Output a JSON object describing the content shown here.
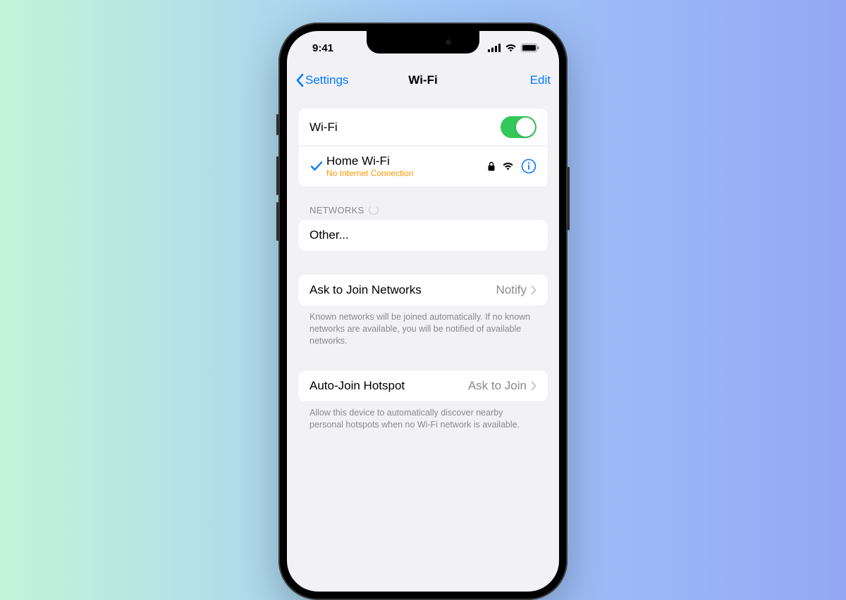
{
  "statusBar": {
    "time": "9:41"
  },
  "nav": {
    "back": "Settings",
    "title": "Wi-Fi",
    "edit": "Edit"
  },
  "wifi": {
    "toggleLabel": "Wi-Fi",
    "connected": {
      "name": "Home Wi-Fi",
      "status": "No Internet Connection"
    }
  },
  "networks": {
    "header": "NETWORKS",
    "other": "Other..."
  },
  "askToJoin": {
    "label": "Ask to Join Networks",
    "value": "Notify",
    "footer": "Known networks will be joined automatically. If no known networks are available, you will be notified of available networks."
  },
  "autoJoin": {
    "label": "Auto-Join Hotspot",
    "value": "Ask to Join",
    "footer": "Allow this device to automatically discover nearby personal hotspots when no Wi-Fi network is available."
  }
}
